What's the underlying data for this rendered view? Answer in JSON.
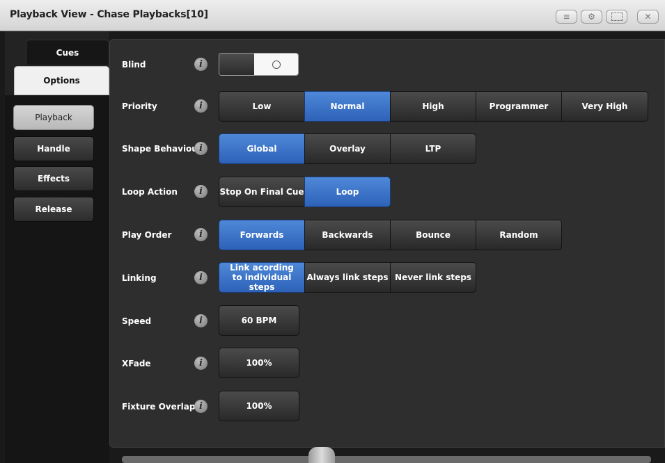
{
  "window": {
    "title": "Playback View - Chase Playbacks[10]",
    "icons": [
      "menu-icon",
      "gear-icon",
      "screenshot-icon",
      "close-icon"
    ]
  },
  "sidebar": {
    "tabs": [
      {
        "label": "Cues",
        "active": false
      },
      {
        "label": "Options",
        "active": true
      }
    ],
    "items": [
      {
        "label": "Playback",
        "active": true
      },
      {
        "label": "Handle",
        "active": false
      },
      {
        "label": "Effects",
        "active": false
      },
      {
        "label": "Release",
        "active": false
      }
    ]
  },
  "options": {
    "blind": {
      "label": "Blind",
      "state": "off"
    },
    "priority": {
      "label": "Priority",
      "options": [
        "Low",
        "Normal",
        "High",
        "Programmer",
        "Very High"
      ],
      "selected": "Normal"
    },
    "shape_behaviour": {
      "label": "Shape Behaviour",
      "options": [
        "Global",
        "Overlay",
        "LTP"
      ],
      "selected": "Global"
    },
    "loop_action": {
      "label": "Loop Action",
      "options": [
        "Stop On Final Cue",
        "Loop"
      ],
      "selected": "Loop"
    },
    "play_order": {
      "label": "Play Order",
      "options": [
        "Forwards",
        "Backwards",
        "Bounce",
        "Random"
      ],
      "selected": "Forwards"
    },
    "linking": {
      "label": "Linking",
      "options": [
        "Link acording to individual steps",
        "Always link steps",
        "Never link steps"
      ],
      "selected": "Link acording to individual steps"
    },
    "speed": {
      "label": "Speed",
      "value": "60 BPM"
    },
    "xfade": {
      "label": "XFade",
      "value": "100%"
    },
    "fixture_overlap": {
      "label": "Fixture Overlap",
      "value": "100%"
    }
  },
  "colors": {
    "selected": "#3a72c8",
    "button": "#3a3a3a",
    "panel": "#2e2e2e"
  }
}
